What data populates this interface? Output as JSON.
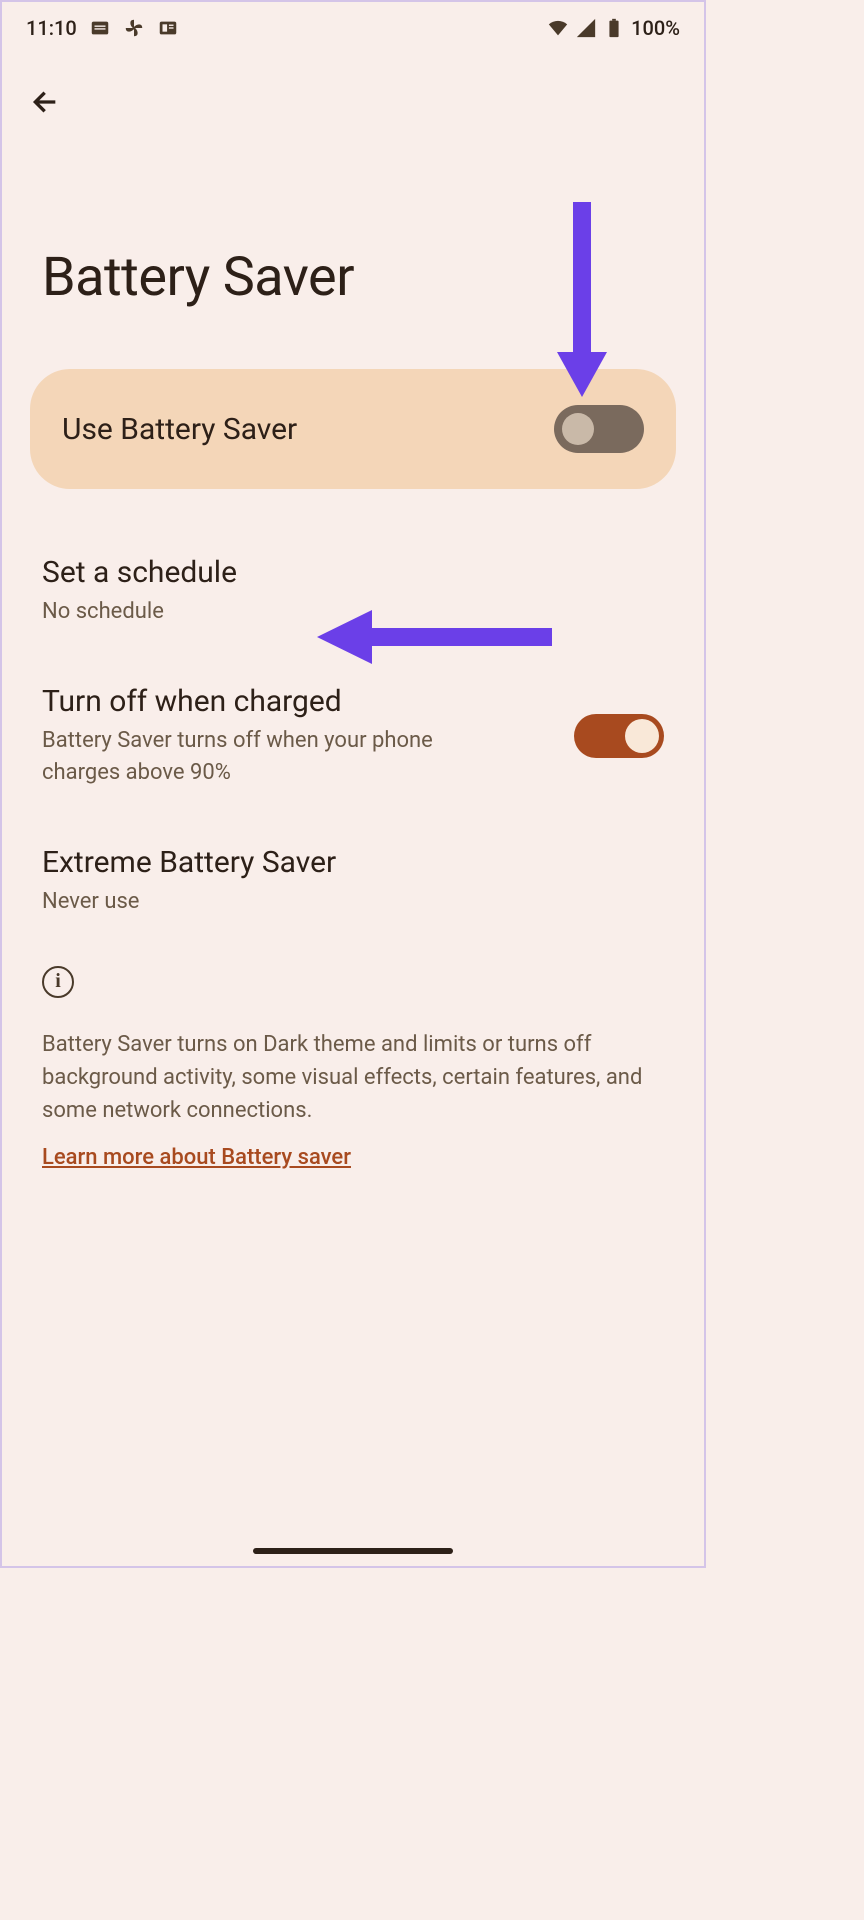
{
  "status": {
    "time": "11:10",
    "battery": "100%"
  },
  "page": {
    "title": "Battery Saver"
  },
  "mainToggle": {
    "label": "Use Battery Saver",
    "enabled": false
  },
  "settings": {
    "schedule": {
      "title": "Set a schedule",
      "subtitle": "No schedule"
    },
    "turnOff": {
      "title": "Turn off when charged",
      "subtitle": "Battery Saver turns off when your phone charges above 90%",
      "enabled": true
    },
    "extreme": {
      "title": "Extreme Battery Saver",
      "subtitle": "Never use"
    }
  },
  "info": {
    "text": "Battery Saver turns on Dark theme and limits or turns off background activity, some visual effects, certain features, and some network connections.",
    "link": "Learn more about Battery saver"
  },
  "annotations": {
    "arrow1": "pointing to main toggle",
    "arrow2": "pointing to schedule setting"
  }
}
